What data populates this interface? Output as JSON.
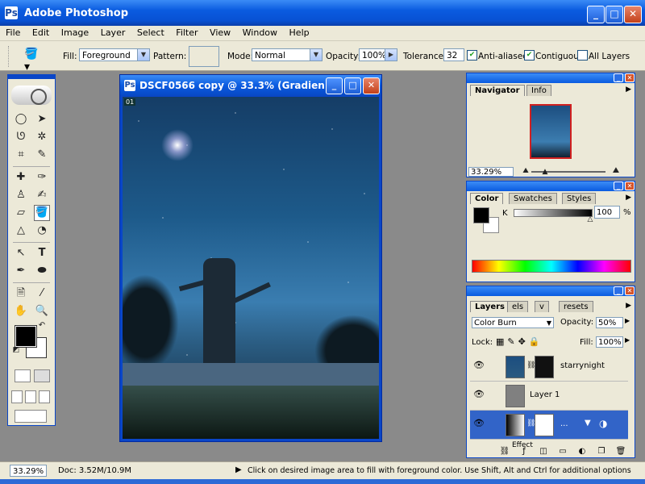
{
  "window": {
    "title": "Adobe Photoshop",
    "icon": "photoshop-app-icon"
  },
  "menu": [
    "File",
    "Edit",
    "Image",
    "Layer",
    "Select",
    "Filter",
    "View",
    "Window",
    "Help"
  ],
  "options": {
    "fill_label": "Fill:",
    "fill_value": "Foreground",
    "pattern_label": "Pattern:",
    "mode_label": "Mode:",
    "mode_value": "Normal",
    "opacity_label": "Opacity:",
    "opacity_value": "100%",
    "tolerance_label": "Tolerance:",
    "tolerance_value": "32",
    "antialiased_label": "Anti-aliased",
    "antialiased_checked": true,
    "contiguous_label": "Contiguous",
    "contiguous_checked": true,
    "all_layers_label": "All Layers",
    "all_layers_checked": false
  },
  "document": {
    "title": "DSCF0566 copy @ 33.3% (Gradien...",
    "badge": "01"
  },
  "navigator": {
    "tab_navigator": "Navigator",
    "tab_info": "Info",
    "zoom": "33.29%"
  },
  "color": {
    "tab_color": "Color",
    "tab_swatches": "Swatches",
    "tab_styles": "Styles",
    "channel_label": "K",
    "channel_value": "100",
    "percent": "%"
  },
  "layers": {
    "tab_layers": "Layers",
    "tab_channels_partial": "els",
    "tab_paths_partial": "v",
    "tab_presets_partial": "resets",
    "blend_mode": "Color Burn",
    "opacity_label": "Opacity:",
    "opacity_value": "50%",
    "lock_label": "Lock:",
    "fill_label": "Fill:",
    "fill_value": "100%",
    "rows": [
      {
        "name": "starrynight",
        "visible": true,
        "selected": false
      },
      {
        "name": "Layer 1",
        "visible": true,
        "selected": false
      },
      {
        "name": "...",
        "visible": true,
        "selected": true
      }
    ],
    "partial_row": "Effect"
  },
  "status": {
    "zoom": "33.29%",
    "doc": "Doc: 3.52M/10.9M",
    "hint": "Click on desired image area to fill with foreground color.  Use Shift, Alt and Ctrl for additional options"
  },
  "colors": {
    "titlebar": "#0a5be0",
    "chrome": "#ece9d8",
    "workspace": "#8a8a8a",
    "selected_layer": "#3264c8"
  }
}
